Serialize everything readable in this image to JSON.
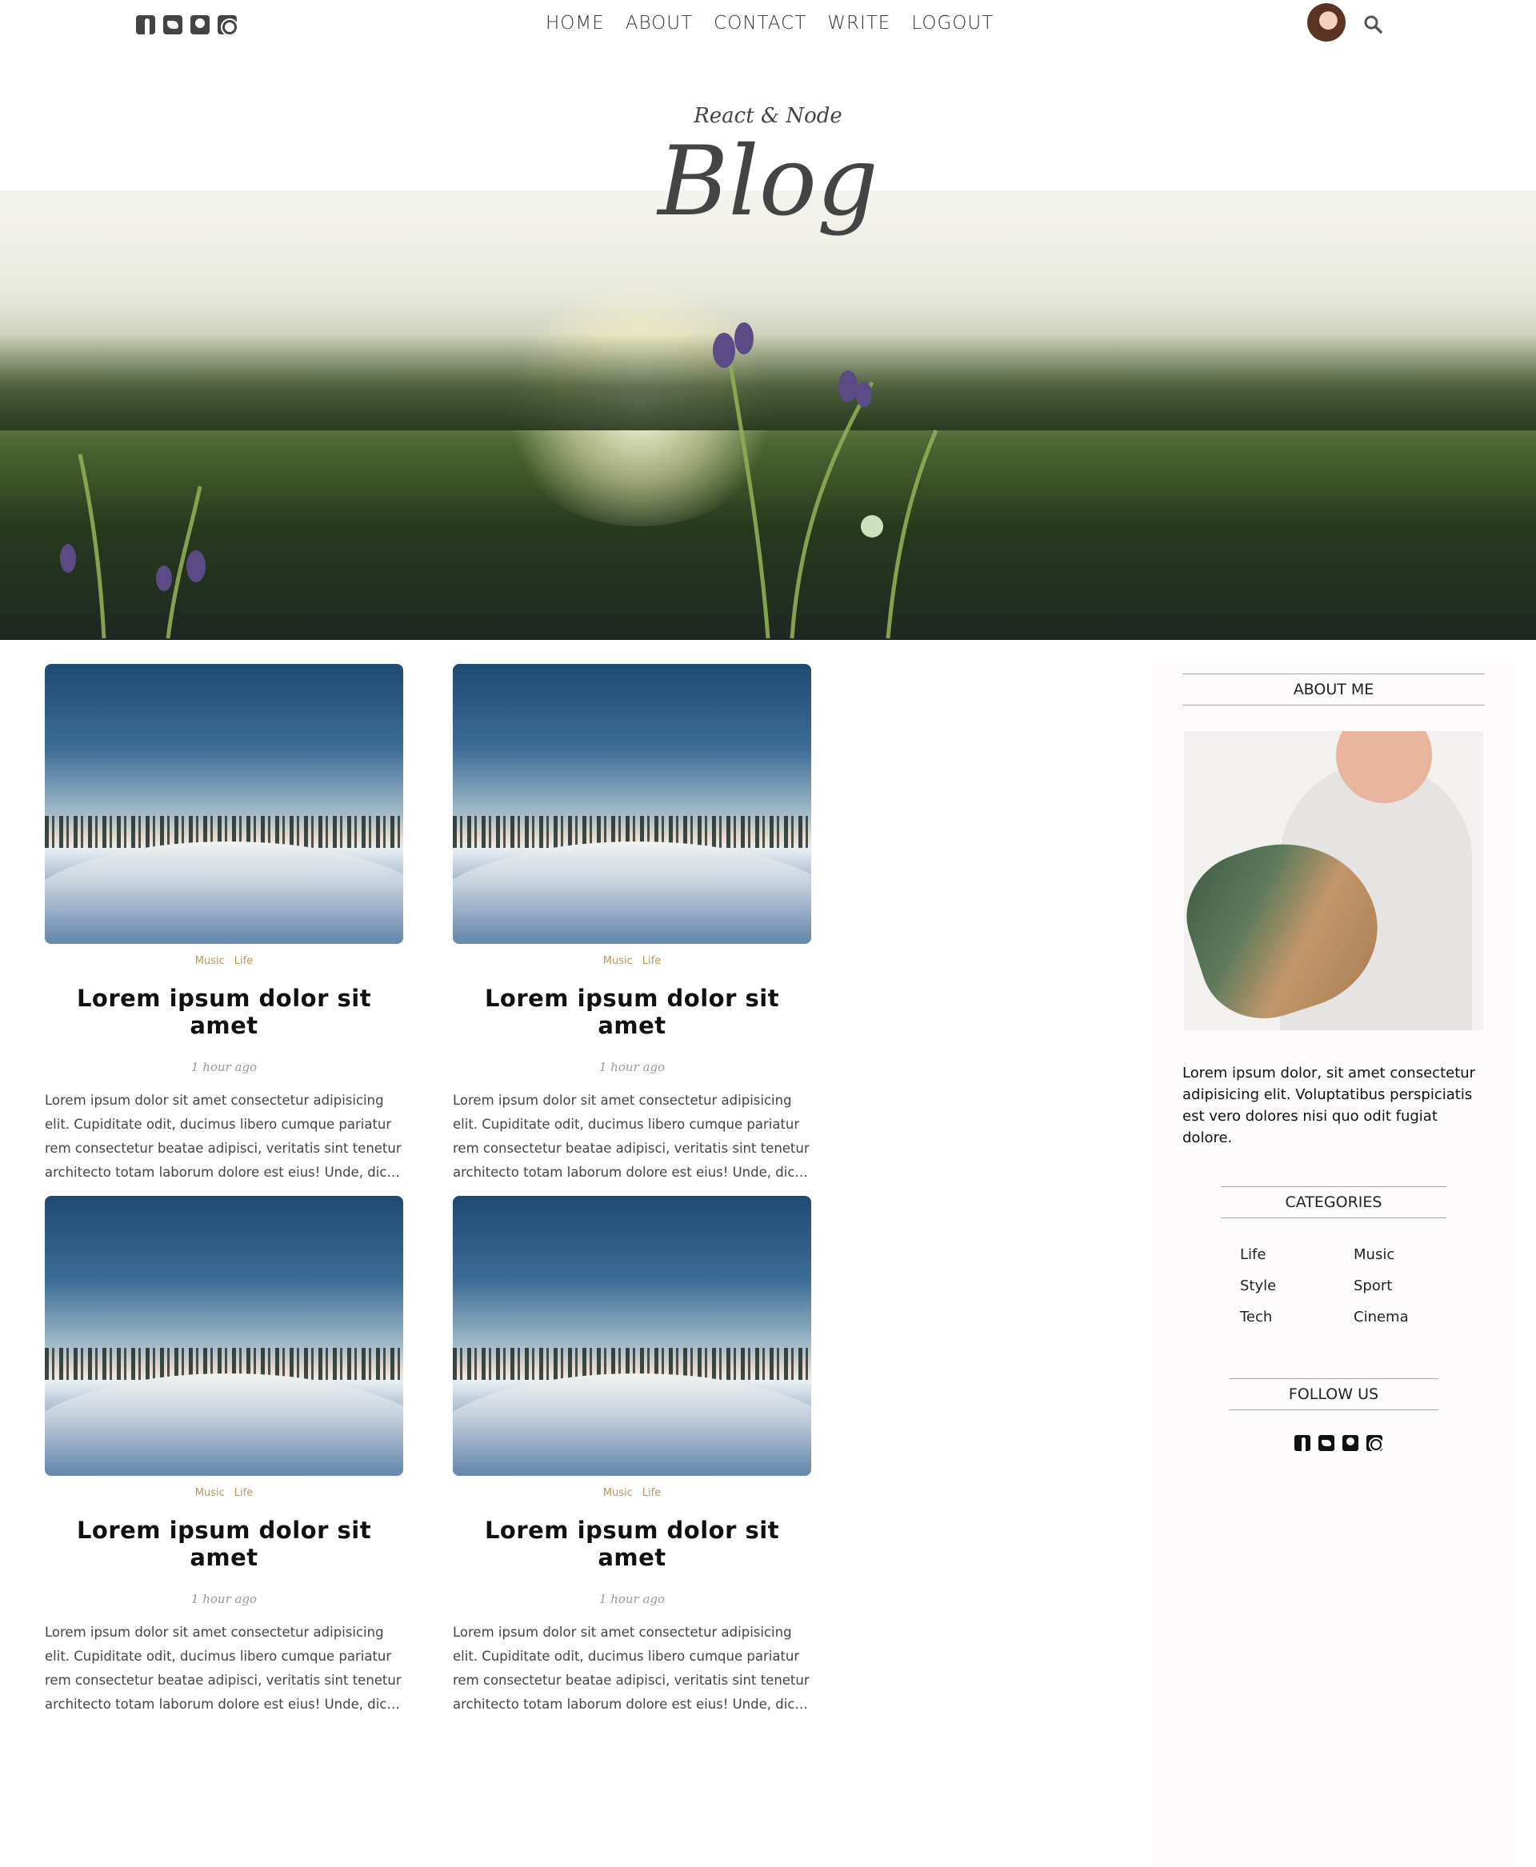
{
  "colors": {
    "accent": "#be9656",
    "text": "#222222",
    "sidebar_bg": "#fdfbfb"
  },
  "social_icons": [
    "facebook-square-icon",
    "twitter-square-icon",
    "pinterest-square-icon",
    "instagram-square-icon"
  ],
  "nav": {
    "items": [
      "HOME",
      "ABOUT",
      "CONTACT",
      "WRITE",
      "LOGOUT"
    ]
  },
  "header": {
    "subtitle": "React & Node",
    "title": "Blog"
  },
  "posts": [
    {
      "categories": [
        "Music",
        "Life"
      ],
      "title": "Lorem ipsum dolor sit amet",
      "date": "1 hour ago",
      "desc": "Lorem ipsum dolor sit amet consectetur adipisicing elit. Cupiditate odit, ducimus libero cumque pariatur rem consectetur beatae adipisci, veritatis sint tenetur architecto totam laborum dolore est eius! Unde, dic…"
    },
    {
      "categories": [
        "Music",
        "Life"
      ],
      "title": "Lorem ipsum dolor sit amet",
      "date": "1 hour ago",
      "desc": "Lorem ipsum dolor sit amet consectetur adipisicing elit. Cupiditate odit, ducimus libero cumque pariatur rem consectetur beatae adipisci, veritatis sint tenetur architecto totam laborum dolore est eius! Unde, dic…"
    },
    {
      "categories": [
        "Music",
        "Life"
      ],
      "title": "Lorem ipsum dolor sit amet",
      "date": "1 hour ago",
      "desc": "Lorem ipsum dolor sit amet consectetur adipisicing elit. Cupiditate odit, ducimus libero cumque pariatur rem consectetur beatae adipisci, veritatis sint tenetur architecto totam laborum dolore est eius! Unde, dic…"
    },
    {
      "categories": [
        "Music",
        "Life"
      ],
      "title": "Lorem ipsum dolor sit amet",
      "date": "1 hour ago",
      "desc": "Lorem ipsum dolor sit amet consectetur adipisicing elit. Cupiditate odit, ducimus libero cumque pariatur rem consectetur beatae adipisci, veritatis sint tenetur architecto totam laborum dolore est eius! Unde, dic…"
    }
  ],
  "sidebar": {
    "about_title": "ABOUT ME",
    "about_text": "Lorem ipsum dolor, sit amet consectetur adipisicing elit. Voluptatibus perspiciatis est vero dolores nisi quo odit fugiat dolore.",
    "categories_title": "CATEGORIES",
    "categories": [
      "Life",
      "Music",
      "Style",
      "Sport",
      "Tech",
      "Cinema"
    ],
    "follow_title": "FOLLOW US"
  }
}
